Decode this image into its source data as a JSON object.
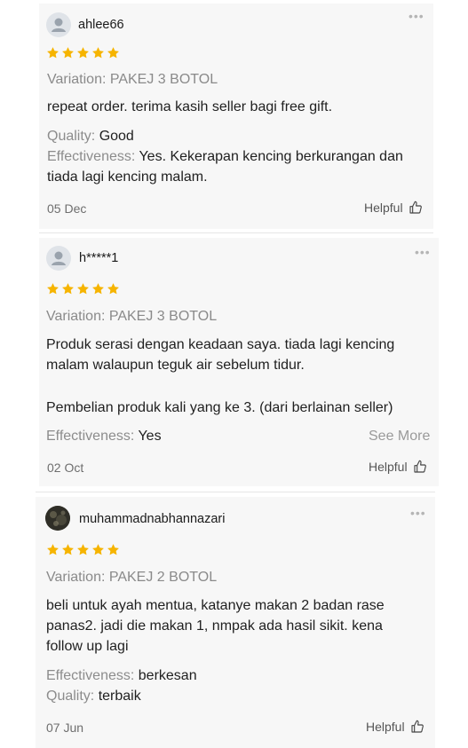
{
  "colors": {
    "star": "#f6b400",
    "label": "#8c8c8c"
  },
  "reviews": [
    {
      "username": "ahlee66",
      "rating": 5,
      "variation": "Variation: PAKEJ 3 BOTOL",
      "comment": "repeat order. terima kasih seller bagi free gift.",
      "quality_label": "Quality: ",
      "quality_value": "Good",
      "effectiveness_label": "Effectiveness: ",
      "effectiveness_line1": "Yes. Kekerapan kencing berkurangan dan",
      "effectiveness_line2": "tiada lagi kencing malam.",
      "date": "05 Dec",
      "helpful": "Helpful"
    },
    {
      "username": "h*****1",
      "rating": 5,
      "variation": "Variation: PAKEJ 3 BOTOL",
      "comment_line1": "Produk serasi dengan keadaan saya. tiada lagi kencing",
      "comment_line2": "malam walaupun teguk air sebelum tidur.",
      "comment_line3": "Pembelian produk kali yang ke 3. (dari berlainan seller)",
      "effectiveness_label": "Effectiveness: ",
      "effectiveness_value": "Yes",
      "see_more": "See More",
      "date": "02 Oct",
      "helpful": "Helpful"
    },
    {
      "username": "muhammadnabhannazari",
      "rating": 5,
      "variation": "Variation: PAKEJ 2 BOTOL",
      "comment_line1": "beli untuk ayah mentua, katanye makan 2 badan rase",
      "comment_line2": "panas2. jadi die makan 1, nmpak ada hasil sikit. kena",
      "comment_line3": "follow up lagi",
      "effectiveness_label": "Effectiveness: ",
      "effectiveness_value": "berkesan",
      "quality_label": "Quality: ",
      "quality_value": "terbaik",
      "date": "07 Jun",
      "helpful": "Helpful"
    }
  ],
  "icons": {
    "more": "more-dots-icon",
    "helpful": "thumbs-up-icon",
    "avatar": "user-avatar-icon",
    "star": "star-icon"
  }
}
